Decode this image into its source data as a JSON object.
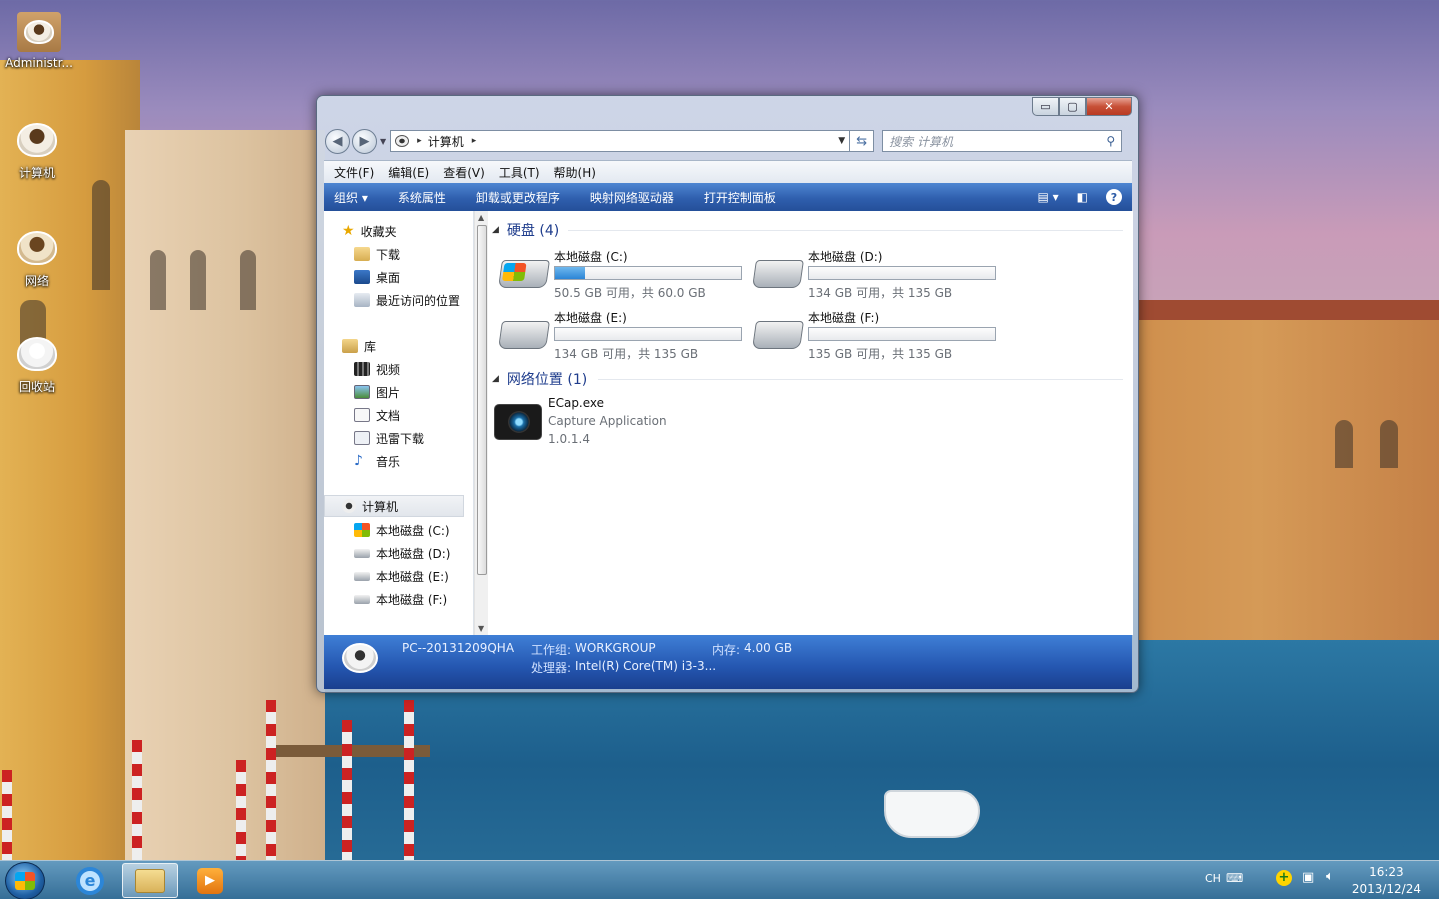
{
  "desktop": {
    "icons": [
      {
        "label": "Administr...",
        "icon": "user-folder-icon"
      },
      {
        "label": "计算机",
        "icon": "computer-icon"
      },
      {
        "label": "网络",
        "icon": "network-icon"
      },
      {
        "label": "回收站",
        "icon": "recycle-bin-icon"
      }
    ]
  },
  "explorer": {
    "caption_buttons": {
      "minimize": "▭",
      "maximize": "▢",
      "close": "✕"
    },
    "address": {
      "crumb": "计算机",
      "separator": "▸"
    },
    "search": {
      "placeholder": "搜索 计算机"
    },
    "menu": [
      "文件(F)",
      "编辑(E)",
      "查看(V)",
      "工具(T)",
      "帮助(H)"
    ],
    "toolbar": {
      "organize": "组织 ▾",
      "items": [
        "系统属性",
        "卸载或更改程序",
        "映射网络驱动器",
        "打开控制面板"
      ],
      "help": "?"
    },
    "sidebar": {
      "favorites": {
        "label": "收藏夹",
        "items": [
          "下载",
          "桌面",
          "最近访问的位置"
        ]
      },
      "libraries": {
        "label": "库",
        "items": [
          "视频",
          "图片",
          "文档",
          "迅雷下载",
          "音乐"
        ]
      },
      "computer": {
        "label": "计算机",
        "items": [
          "本地磁盘 (C:)",
          "本地磁盘 (D:)",
          "本地磁盘 (E:)",
          "本地磁盘 (F:)"
        ]
      }
    },
    "groups": {
      "drives_header": "硬盘 (4)",
      "network_header": "网络位置 (1)"
    },
    "drives": [
      {
        "name": "本地磁盘 (C:)",
        "free_text": "50.5 GB 可用，共 60.0 GB",
        "used_fraction": 0.16,
        "system": true
      },
      {
        "name": "本地磁盘 (D:)",
        "free_text": "134 GB 可用，共 135 GB",
        "used_fraction": 0.0,
        "system": false
      },
      {
        "name": "本地磁盘 (E:)",
        "free_text": "134 GB 可用，共 135 GB",
        "used_fraction": 0.0,
        "system": false
      },
      {
        "name": "本地磁盘 (F:)",
        "free_text": "135 GB 可用，共 135 GB",
        "used_fraction": 0.0,
        "system": false
      }
    ],
    "network_item": {
      "name": "ECap.exe",
      "description": "Capture Application",
      "version": "1.0.1.4"
    },
    "details": {
      "computer_name": "PC--20131209QHA",
      "workgroup_label": "工作组:",
      "workgroup": "WORKGROUP",
      "memory_label": "内存:",
      "memory": "4.00 GB",
      "processor_label": "处理器:",
      "processor": "Intel(R) Core(TM) i3-3..."
    }
  },
  "taskbar": {
    "tray": {
      "lang": "CH"
    },
    "clock": {
      "time": "16:23",
      "date": "2013/12/24"
    }
  }
}
